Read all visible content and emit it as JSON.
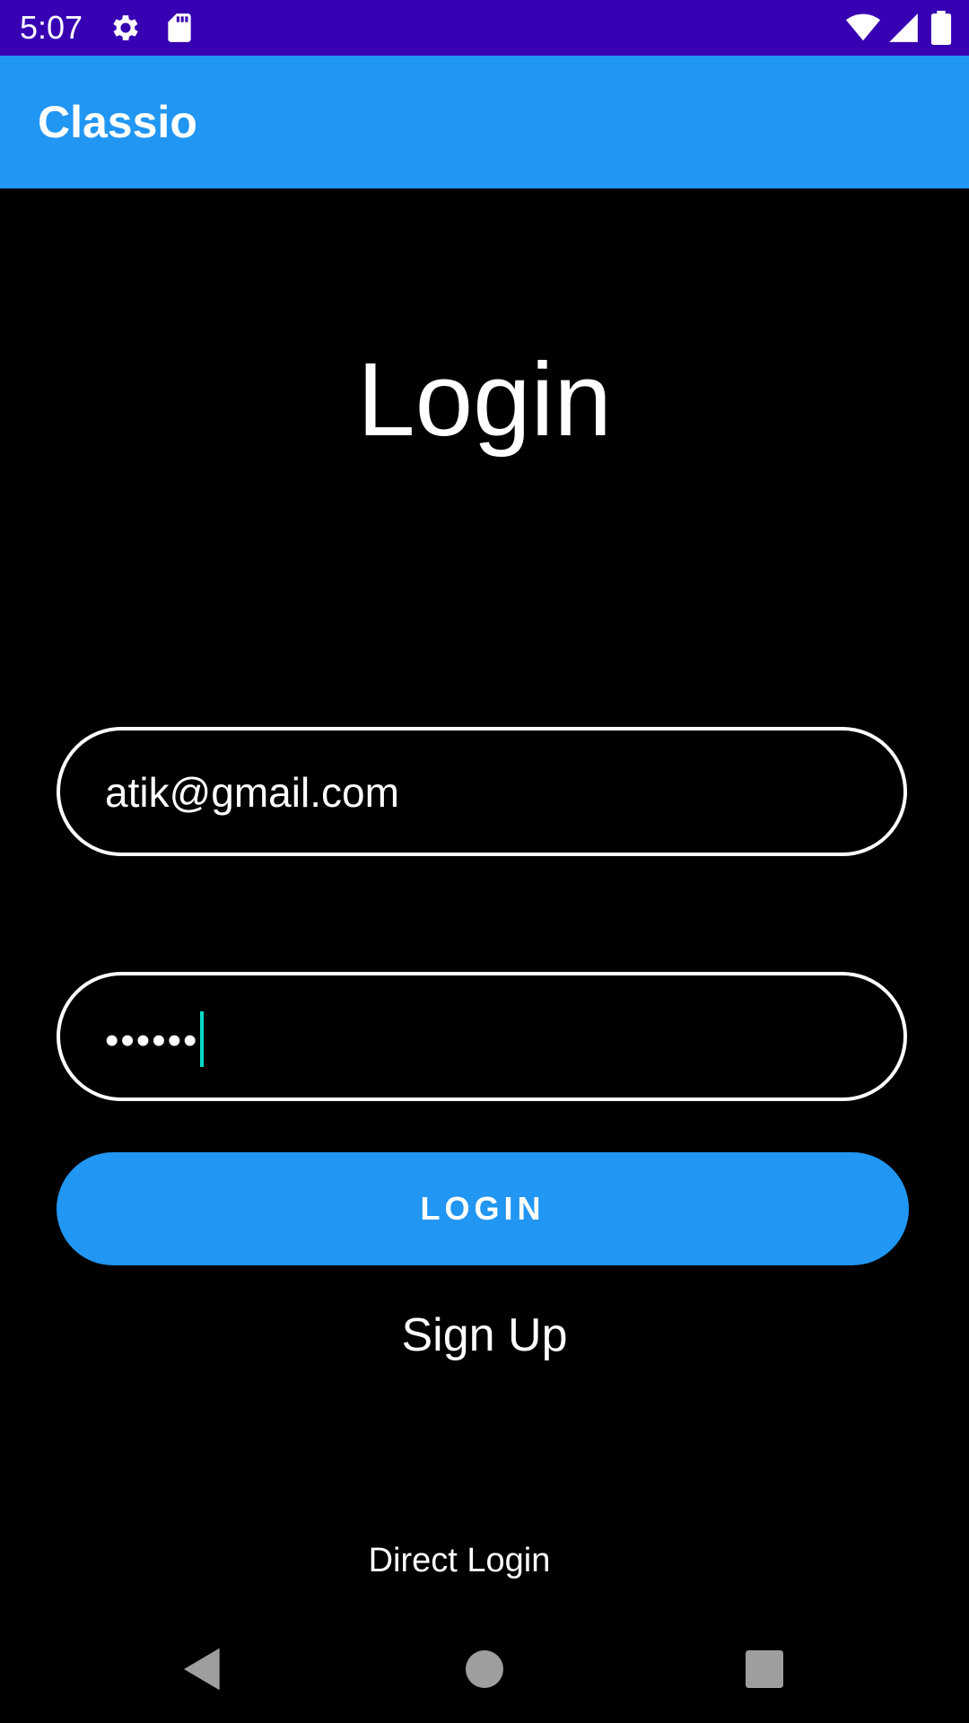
{
  "status_bar": {
    "time": "5:07",
    "left_icons": [
      "gear-icon",
      "sd-card-icon"
    ],
    "right_icons": [
      "wifi-icon",
      "cell-signal-icon",
      "battery-icon"
    ],
    "background": "#3700B3"
  },
  "app_bar": {
    "title": "Classio",
    "background": "#2196F3"
  },
  "screen": {
    "heading": "Login",
    "background": "#000000"
  },
  "form": {
    "email_value": "atik@gmail.com",
    "password_value": "••••••",
    "login_label": "LOGIN",
    "signup_label": "Sign Up",
    "direct_login_label": "Direct Login",
    "cursor_color": "#03DAC5"
  },
  "nav_bar": {
    "buttons": [
      "back-icon",
      "home-icon",
      "recents-icon"
    ]
  }
}
